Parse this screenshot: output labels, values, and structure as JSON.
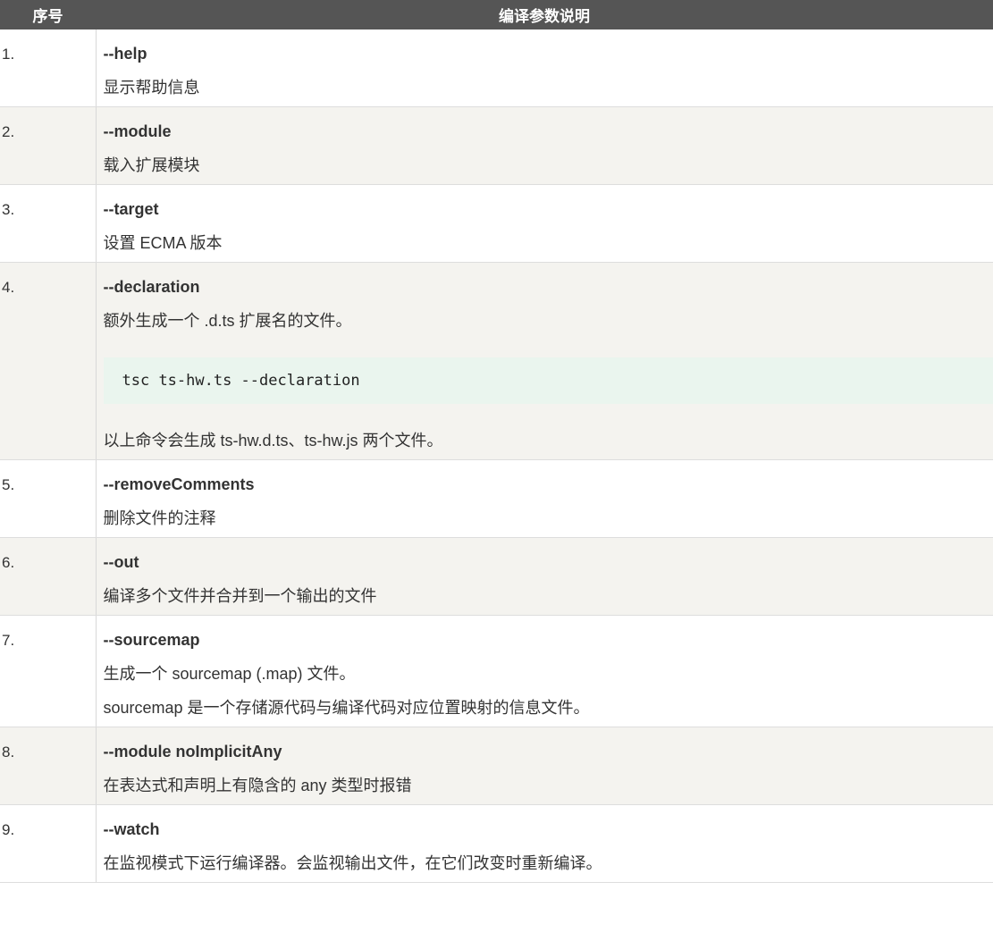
{
  "table": {
    "headers": {
      "number": "序号",
      "description": "编译参数说明"
    },
    "rows": [
      {
        "num": "1.",
        "flag": "--help",
        "lines": [
          "显示帮助信息"
        ]
      },
      {
        "num": "2.",
        "flag": "--module",
        "lines": [
          "载入扩展模块"
        ]
      },
      {
        "num": "3.",
        "flag": "--target",
        "lines": [
          "设置 ECMA 版本"
        ]
      },
      {
        "num": "4.",
        "flag": "--declaration",
        "lines": [
          "额外生成一个 .d.ts 扩展名的文件。"
        ],
        "code": "tsc ts-hw.ts --declaration",
        "after_code": "以上命令会生成 ts-hw.d.ts、ts-hw.js 两个文件。"
      },
      {
        "num": "5.",
        "flag": "--removeComments",
        "lines": [
          "删除文件的注释"
        ]
      },
      {
        "num": "6.",
        "flag": "--out",
        "lines": [
          "编译多个文件并合并到一个输出的文件"
        ]
      },
      {
        "num": "7.",
        "flag": "--sourcemap",
        "lines": [
          "生成一个 sourcemap (.map) 文件。",
          "sourcemap 是一个存储源代码与编译代码对应位置映射的信息文件。"
        ]
      },
      {
        "num": "8.",
        "flag": "--module noImplicitAny",
        "lines": [
          "在表达式和声明上有隐含的 any 类型时报错"
        ]
      },
      {
        "num": "9.",
        "flag": "--watch",
        "lines": [
          "在监视模式下运行编译器。会监视输出文件，在它们改变时重新编译。"
        ]
      }
    ]
  }
}
